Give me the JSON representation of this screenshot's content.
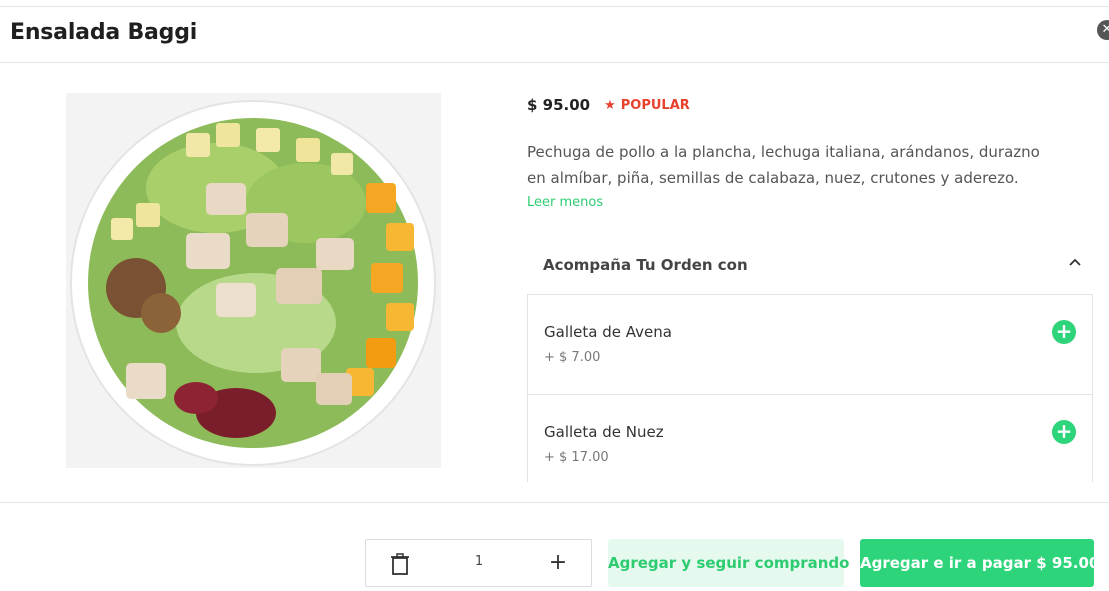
{
  "product": {
    "title": "Ensalada Baggi",
    "price": "$ 95.00",
    "badge": "POPULAR",
    "description": "Pechuga de pollo a la plancha, lechuga italiana, arándanos, durazno en almíbar, piña, semillas de calabaza, nuez, crutones y aderezo.",
    "read_less": "Leer menos",
    "image_icon": "salad-bowl-photo"
  },
  "extras": {
    "title": "Acompaña Tu Orden con",
    "items": [
      {
        "name": "Galleta de Avena",
        "price": "+ $ 7.00"
      },
      {
        "name": "Galleta de Nuez",
        "price": "+ $ 17.00"
      }
    ]
  },
  "footer": {
    "quantity": "1",
    "continue_label": "Agregar y seguir comprando",
    "pay_label": "Agregar e ir a pagar $ 95.00"
  },
  "colors": {
    "accent": "#2ed47a",
    "accent_light": "#e6f9ee",
    "popular": "#e8412c"
  }
}
